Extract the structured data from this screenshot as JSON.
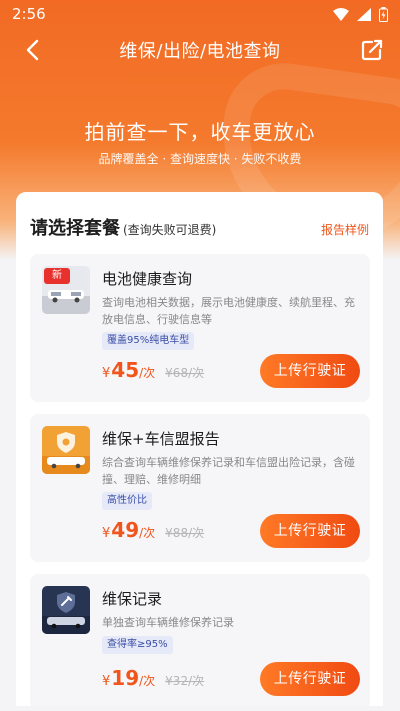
{
  "status_bar": {
    "time": "2:56"
  },
  "nav": {
    "title": "维保/出险/电池查询"
  },
  "hero": {
    "slogan": "拍前查一下，收车更放心",
    "sub_slogan": "品牌覆盖全 · 查询速度快 · 失败不收费"
  },
  "panel": {
    "title": "请选择套餐",
    "note": "(查询失败可退费)",
    "sample_link": "报告样例"
  },
  "packages": [
    {
      "name": "电池健康查询",
      "tag": "新",
      "desc": "查询电池相关数据，展示电池健康度、续航里程、充放电信息、行驶信息等",
      "badge": "覆盖95%纯电车型",
      "currency": "¥",
      "price": "45",
      "unit": "/次",
      "old_price": "¥68/次",
      "button": "上传行驶证"
    },
    {
      "name": "维保+车信盟报告",
      "desc": "综合查询车辆维修保养记录和车信盟出险记录，含碰撞、理赔、维修明细",
      "badge": "高性价比",
      "currency": "¥",
      "price": "49",
      "unit": "/次",
      "old_price": "¥88/次",
      "button": "上传行驶证"
    },
    {
      "name": "维保记录",
      "desc": "单独查询车辆维修保养记录",
      "badge": "查得率≥95%",
      "currency": "¥",
      "price": "19",
      "unit": "/次",
      "old_price": "¥32/次",
      "button": "上传行驶证"
    }
  ],
  "colors": {
    "accent": "#f0551b",
    "badge_text": "#3a4ea8"
  }
}
